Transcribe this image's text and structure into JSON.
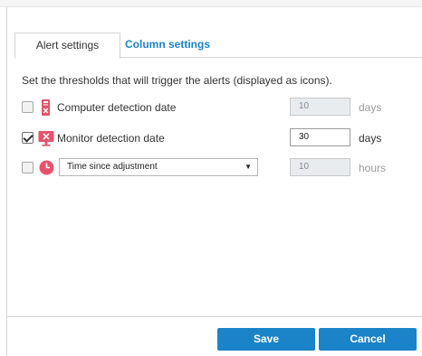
{
  "tabs": [
    {
      "label": "Alert settings",
      "active": true
    },
    {
      "label": "Column settings",
      "active": false
    }
  ],
  "description": "Set the thresholds that will trigger the alerts (displayed as icons).",
  "alerts": [
    {
      "label": "Computer detection date",
      "checked": false,
      "value": "10",
      "unit": "days",
      "enabled": false,
      "icon": "computer-alert-icon",
      "icon_color": "#e8516b"
    },
    {
      "label": "Monitor detection date",
      "checked": true,
      "value": "30",
      "unit": "days",
      "enabled": true,
      "icon": "monitor-alert-icon",
      "icon_color": "#e8516b"
    },
    {
      "select_value": "Time since adjustment",
      "checked": false,
      "value": "10",
      "unit": "hours",
      "enabled": false,
      "icon": "clock-icon",
      "icon_color": "#e8516b"
    }
  ],
  "buttons": {
    "save": "Save",
    "cancel": "Cancel"
  },
  "colors": {
    "accent": "#1b83c7",
    "alert": "#e8516b"
  }
}
